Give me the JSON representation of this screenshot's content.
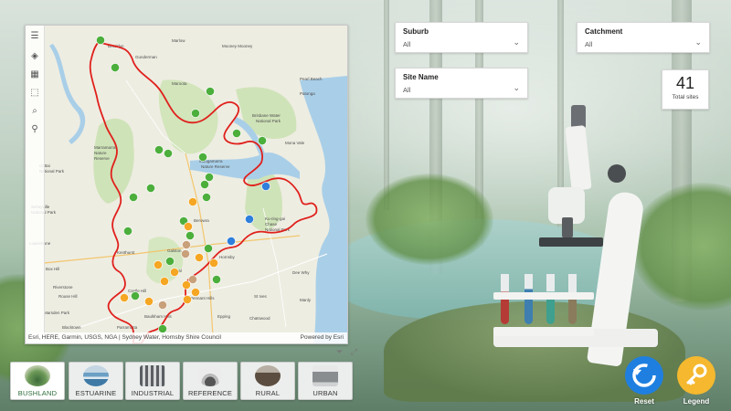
{
  "map": {
    "toolbar": [
      {
        "name": "menu-icon",
        "glyph": "☰"
      },
      {
        "name": "layers-icon",
        "glyph": "◈"
      },
      {
        "name": "basemap-icon",
        "glyph": "▦"
      },
      {
        "name": "select-icon",
        "glyph": "⬚"
      },
      {
        "name": "search-icon",
        "glyph": "⌕"
      },
      {
        "name": "locate-icon",
        "glyph": "⚲"
      }
    ],
    "attribution": "Esri, HERE, Garmin, USGS, NGA | Sydney Water, Hornsby Shire Council",
    "powered_by": "Powered by Esri",
    "place_labels": [
      "Brooklyn",
      "Gunderman",
      "Marlow",
      "Mooney Mooney",
      "Pearl Beach",
      "Patonga",
      "Bilgola",
      "Brisbane Water National Park",
      "Mona Vale",
      "Maroota",
      "Berowra",
      "Galston",
      "Dural",
      "Hornsby",
      "Pennant Hills",
      "Ku-ring-gai Chase National Park",
      "St Ives",
      "Castle Hill",
      "Kenthurst",
      "Glenorie",
      "Dural",
      "Cattai",
      "Box Hill",
      "Marsden Park",
      "Windsor",
      "Pitt Town",
      "Sackville",
      "Wiseman's Ferry",
      "Vineyard",
      "Blacktown",
      "Kellyville",
      "Baulkham Hills",
      "North Rocks",
      "Parramatta",
      "Epping",
      "Chatswood",
      "Manly",
      "Dee Why",
      "Riverstone",
      "Rouse Hill",
      "Scheyville National Park",
      "Cattai National Park",
      "Marramarra National Park",
      "Muogamarra Nature Reserve",
      "Lower Portland",
      "Ebenezer",
      "Wilberforce",
      "Richmond"
    ],
    "legend_colors": {
      "bushland": "#4caf3c",
      "industrial": "#f5a623",
      "rural": "#c8a07a",
      "estuarine": "#2f7fdc",
      "boundary": "#e0201c"
    }
  },
  "filters": {
    "suburb": {
      "title": "Suburb",
      "value": "All"
    },
    "catchment": {
      "title": "Catchment",
      "value": "All"
    },
    "site_name": {
      "title": "Site Name",
      "value": "All"
    }
  },
  "kpi": {
    "value": "41",
    "label": "Total sites"
  },
  "categories": [
    {
      "label": "BUSHLAND",
      "icon": "bushland-icon"
    },
    {
      "label": "ESTUARINE",
      "icon": "estuarine-icon"
    },
    {
      "label": "INDUSTRIAL",
      "icon": "industrial-icon"
    },
    {
      "label": "REFERENCE",
      "icon": "reference-icon"
    },
    {
      "label": "RURAL",
      "icon": "rural-icon"
    },
    {
      "label": "URBAN",
      "icon": "urban-icon"
    }
  ],
  "actions": {
    "reset": {
      "label": "Reset",
      "color": "#1f7fe0"
    },
    "legend": {
      "label": "Legend",
      "color": "#f5b82e"
    }
  }
}
